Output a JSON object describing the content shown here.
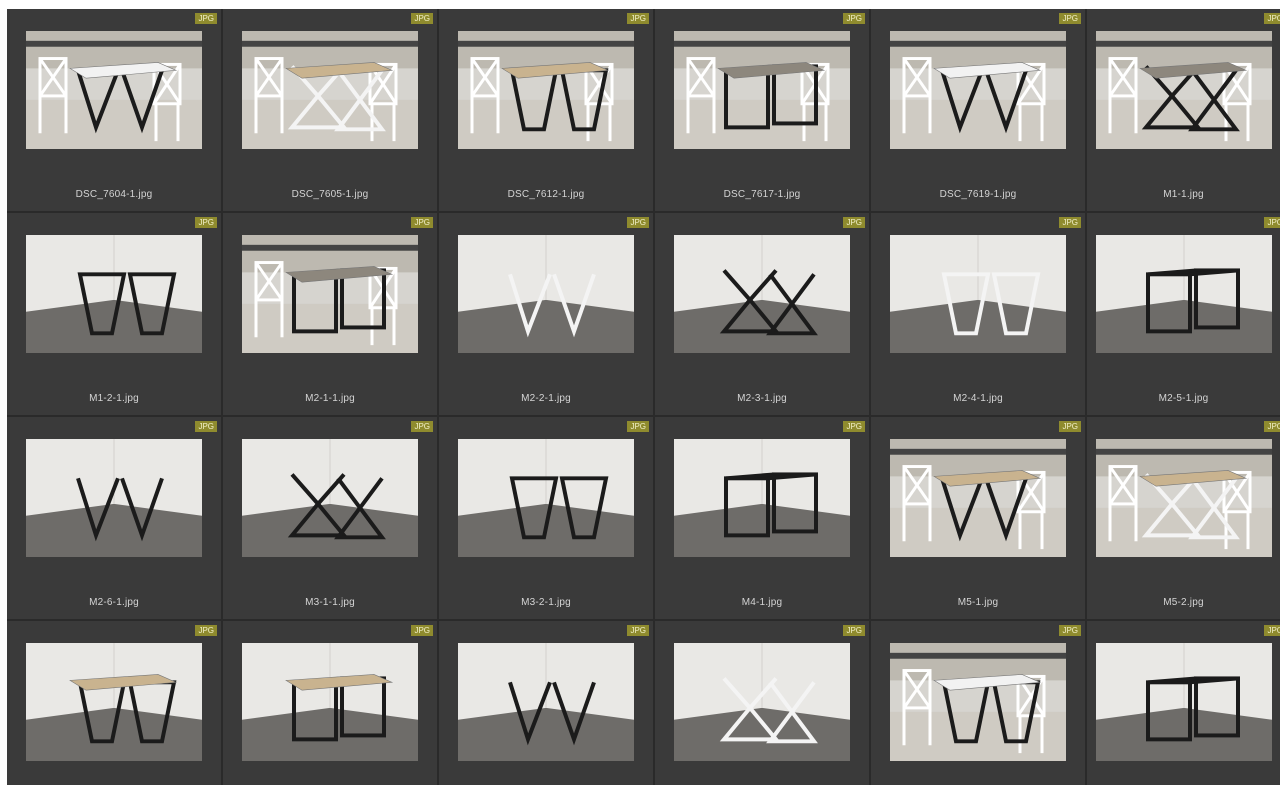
{
  "format_badge": "JPG",
  "files": [
    {
      "name": "DSC_7604-1.jpg",
      "scene": "cafe",
      "legs": "black",
      "top": "white"
    },
    {
      "name": "DSC_7605-1.jpg",
      "scene": "cafe",
      "legs": "white",
      "top": "wood"
    },
    {
      "name": "DSC_7612-1.jpg",
      "scene": "cafe",
      "legs": "black",
      "top": "wood"
    },
    {
      "name": "DSC_7617-1.jpg",
      "scene": "cafe",
      "legs": "black",
      "top": "gray"
    },
    {
      "name": "DSC_7619-1.jpg",
      "scene": "cafe",
      "legs": "black",
      "top": "white"
    },
    {
      "name": "M1-1.jpg",
      "scene": "cafe",
      "legs": "black",
      "top": "gray"
    },
    {
      "name": "M1-2-1.jpg",
      "scene": "studio",
      "legs": "black",
      "top": "none"
    },
    {
      "name": "M2-1-1.jpg",
      "scene": "cafe",
      "legs": "black",
      "top": "gray"
    },
    {
      "name": "M2-2-1.jpg",
      "scene": "studio",
      "legs": "white",
      "top": "none"
    },
    {
      "name": "M2-3-1.jpg",
      "scene": "studio",
      "legs": "black",
      "top": "none"
    },
    {
      "name": "M2-4-1.jpg",
      "scene": "studio",
      "legs": "white",
      "top": "none"
    },
    {
      "name": "M2-5-1.jpg",
      "scene": "studio",
      "legs": "black",
      "top": "none"
    },
    {
      "name": "M2-6-1.jpg",
      "scene": "studio",
      "legs": "black",
      "top": "none"
    },
    {
      "name": "M3-1-1.jpg",
      "scene": "studio",
      "legs": "black",
      "top": "none"
    },
    {
      "name": "M3-2-1.jpg",
      "scene": "studio",
      "legs": "black",
      "top": "none"
    },
    {
      "name": "M4-1.jpg",
      "scene": "studio",
      "legs": "black",
      "top": "none"
    },
    {
      "name": "M5-1.jpg",
      "scene": "cafe",
      "legs": "black",
      "top": "wood"
    },
    {
      "name": "M5-2.jpg",
      "scene": "cafe",
      "legs": "white",
      "top": "wood"
    },
    {
      "name": "",
      "scene": "studio",
      "legs": "black",
      "top": "wood"
    },
    {
      "name": "",
      "scene": "studio",
      "legs": "black",
      "top": "wood"
    },
    {
      "name": "",
      "scene": "studio",
      "legs": "black",
      "top": "none"
    },
    {
      "name": "",
      "scene": "studio",
      "legs": "white",
      "top": "none"
    },
    {
      "name": "",
      "scene": "cafe",
      "legs": "black",
      "top": "white"
    },
    {
      "name": "",
      "scene": "studio",
      "legs": "black",
      "top": "none"
    }
  ],
  "colors": {
    "grid_background": "#2a2a2a",
    "cell_background": "#3a3a3a",
    "badge_background": "#8f8b2e",
    "badge_text": "#f2f0c8",
    "caption_text": "#d4d4d4"
  }
}
